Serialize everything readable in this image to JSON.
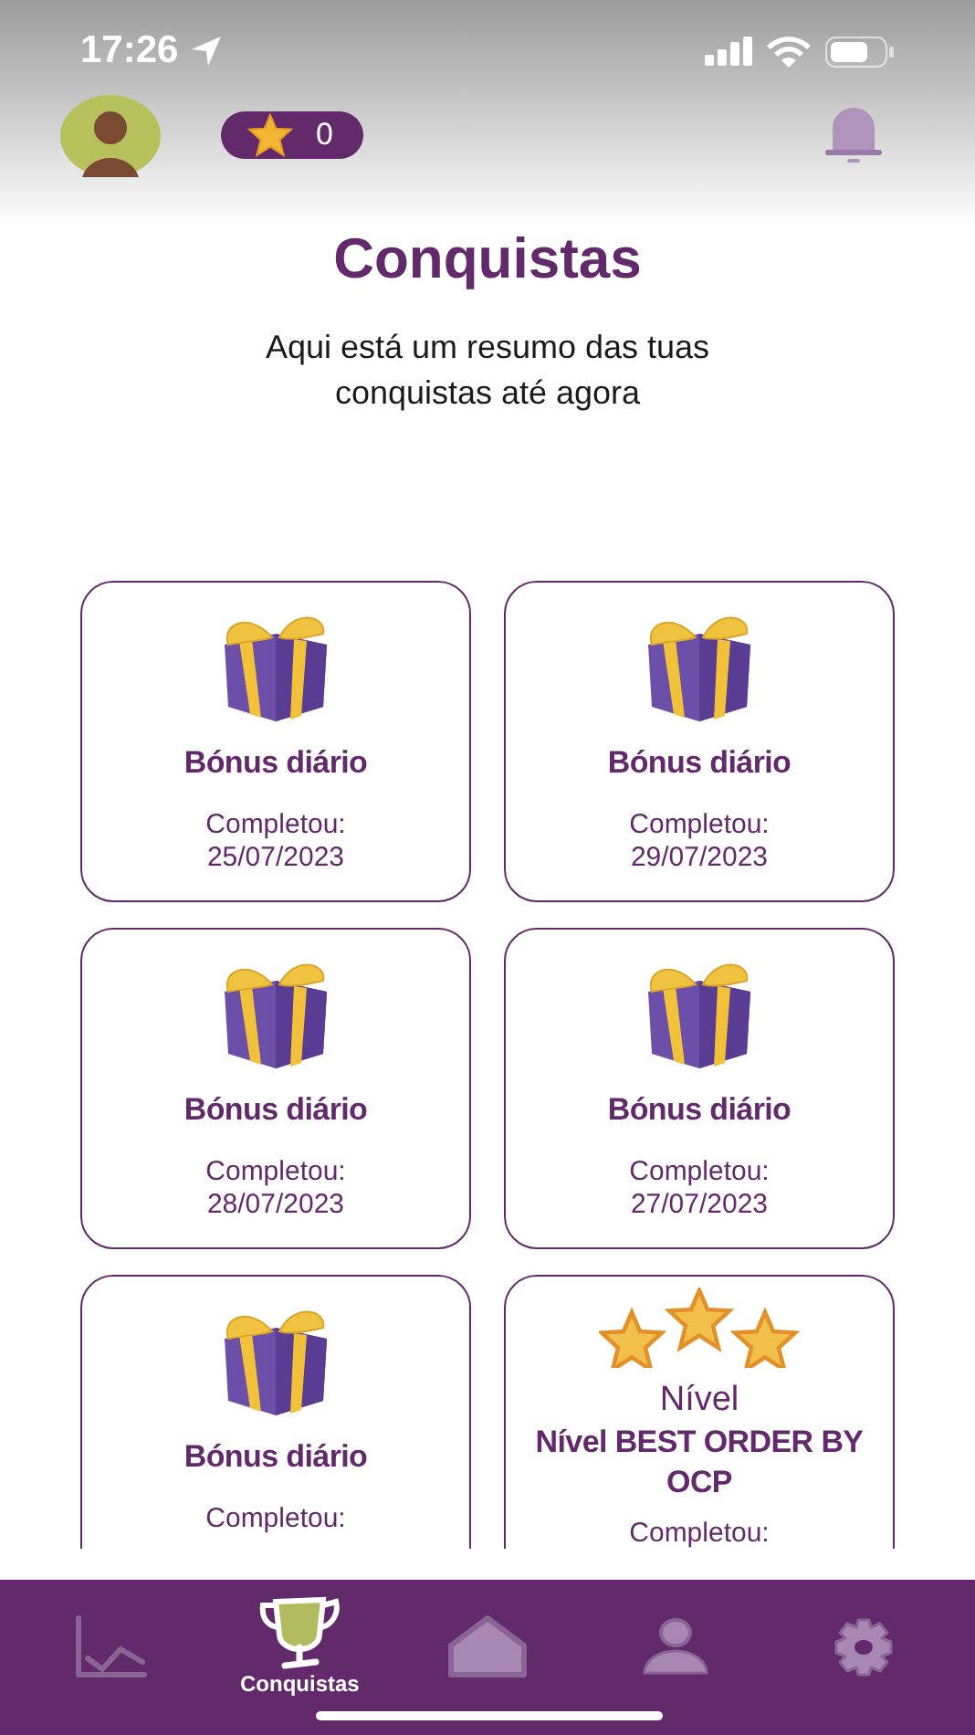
{
  "status_bar": {
    "time": "17:26"
  },
  "header": {
    "points": "0"
  },
  "title": "Conquistas",
  "subtitle": "Aqui está um resumo das tuas conquistas até agora",
  "achievement_rows": [
    {
      "cards": [
        {
          "kind": "gift",
          "title": "Bónus diário",
          "completed_label": "Completou:",
          "date": "25/07/2023"
        },
        {
          "kind": "gift",
          "title": "Bónus diário",
          "completed_label": "Completou:",
          "date": "29/07/2023"
        }
      ]
    },
    {
      "cards": [
        {
          "kind": "gift",
          "title": "Bónus diário",
          "completed_label": "Completou:",
          "date": "28/07/2023"
        },
        {
          "kind": "gift",
          "title": "Bónus diário",
          "completed_label": "Completou:",
          "date": "27/07/2023"
        }
      ]
    },
    {
      "cards": [
        {
          "kind": "gift",
          "title": "Bónus diário",
          "completed_label": "Completou:"
        },
        {
          "kind": "stars",
          "label": "Nível",
          "title": "Nível BEST ORDER BY OCP",
          "completed_label": "Completou:"
        }
      ]
    }
  ],
  "tab_bar": [
    {
      "kind": "chart",
      "selected": false
    },
    {
      "kind": "trophy",
      "label": "Conquistas",
      "selected": true
    },
    {
      "kind": "home",
      "selected": false
    },
    {
      "kind": "person",
      "selected": false
    },
    {
      "kind": "settings",
      "selected": false
    }
  ]
}
